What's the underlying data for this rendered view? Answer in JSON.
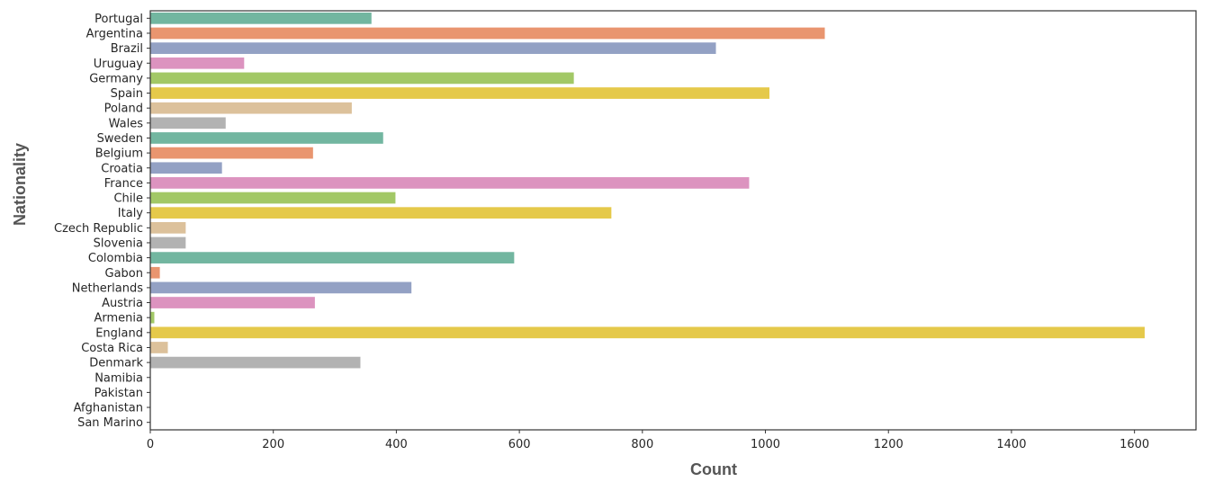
{
  "chart_data": {
    "type": "bar",
    "orientation": "horizontal",
    "title": "",
    "xlabel": "Count",
    "ylabel": "Nationality",
    "xlim": [
      0,
      1700
    ],
    "grid": false,
    "legend": "none",
    "xticks": [
      0,
      200,
      400,
      600,
      800,
      1000,
      1200,
      1400,
      1600
    ],
    "xtick_labels": [
      "0",
      "200",
      "400",
      "600",
      "800",
      "1000",
      "1200",
      "1400",
      "1600"
    ],
    "categories": [
      "Portugal",
      "Argentina",
      "Brazil",
      "Uruguay",
      "Germany",
      "Spain",
      "Poland",
      "Wales",
      "Sweden",
      "Belgium",
      "Croatia",
      "France",
      "Chile",
      "Italy",
      "Czech Republic",
      "Slovenia",
      "Colombia",
      "Gabon",
      "Netherlands",
      "Austria",
      "Armenia",
      "England",
      "Costa Rica",
      "Denmark",
      "Namibia",
      "Pakistan",
      "Afghanistan",
      "San Marino"
    ],
    "values": [
      360,
      1097,
      920,
      153,
      689,
      1007,
      328,
      123,
      379,
      265,
      117,
      974,
      399,
      750,
      58,
      58,
      592,
      16,
      425,
      268,
      7,
      1617,
      29,
      342,
      1,
      1,
      1,
      1
    ],
    "palette": [
      "#72b6a0",
      "#e9956f",
      "#93a1c4",
      "#dc93bf",
      "#a2c866",
      "#e5c94a",
      "#dcc19b",
      "#b2b2b2"
    ]
  }
}
